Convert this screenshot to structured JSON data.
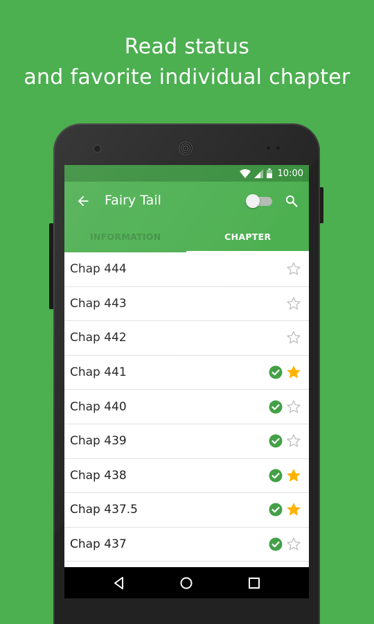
{
  "headline": {
    "line1": "Read status",
    "line2": "and favorite individual chapter"
  },
  "statusbar": {
    "time": "10:00",
    "icons": [
      "wifi-icon",
      "cell-signal-icon",
      "battery-icon"
    ]
  },
  "appbar": {
    "title": "Fairy Tail",
    "back_icon": "arrow-left-icon",
    "toggle_on": false,
    "search_icon": "search-icon"
  },
  "tabs": [
    {
      "label": "INFORMATION",
      "active": false
    },
    {
      "label": "CHAPTER",
      "active": true
    }
  ],
  "chapters": [
    {
      "label": "Chap 444",
      "read": false,
      "favorite": false
    },
    {
      "label": "Chap 443",
      "read": false,
      "favorite": false
    },
    {
      "label": "Chap 442",
      "read": false,
      "favorite": false
    },
    {
      "label": "Chap 441",
      "read": true,
      "favorite": true
    },
    {
      "label": "Chap 440",
      "read": true,
      "favorite": false
    },
    {
      "label": "Chap 439",
      "read": true,
      "favorite": false
    },
    {
      "label": "Chap 438",
      "read": true,
      "favorite": true
    },
    {
      "label": "Chap 437.5",
      "read": true,
      "favorite": true
    },
    {
      "label": "Chap 437",
      "read": true,
      "favorite": false
    }
  ],
  "navbar": {
    "icons": [
      "back-triangle-icon",
      "home-circle-icon",
      "recents-square-icon"
    ]
  },
  "colors": {
    "background": "#4caf50",
    "statusbar": "#388e3c",
    "read_check": "#43a047",
    "favorite_star": "#ffb300",
    "empty_star": "#bdbdbd"
  }
}
